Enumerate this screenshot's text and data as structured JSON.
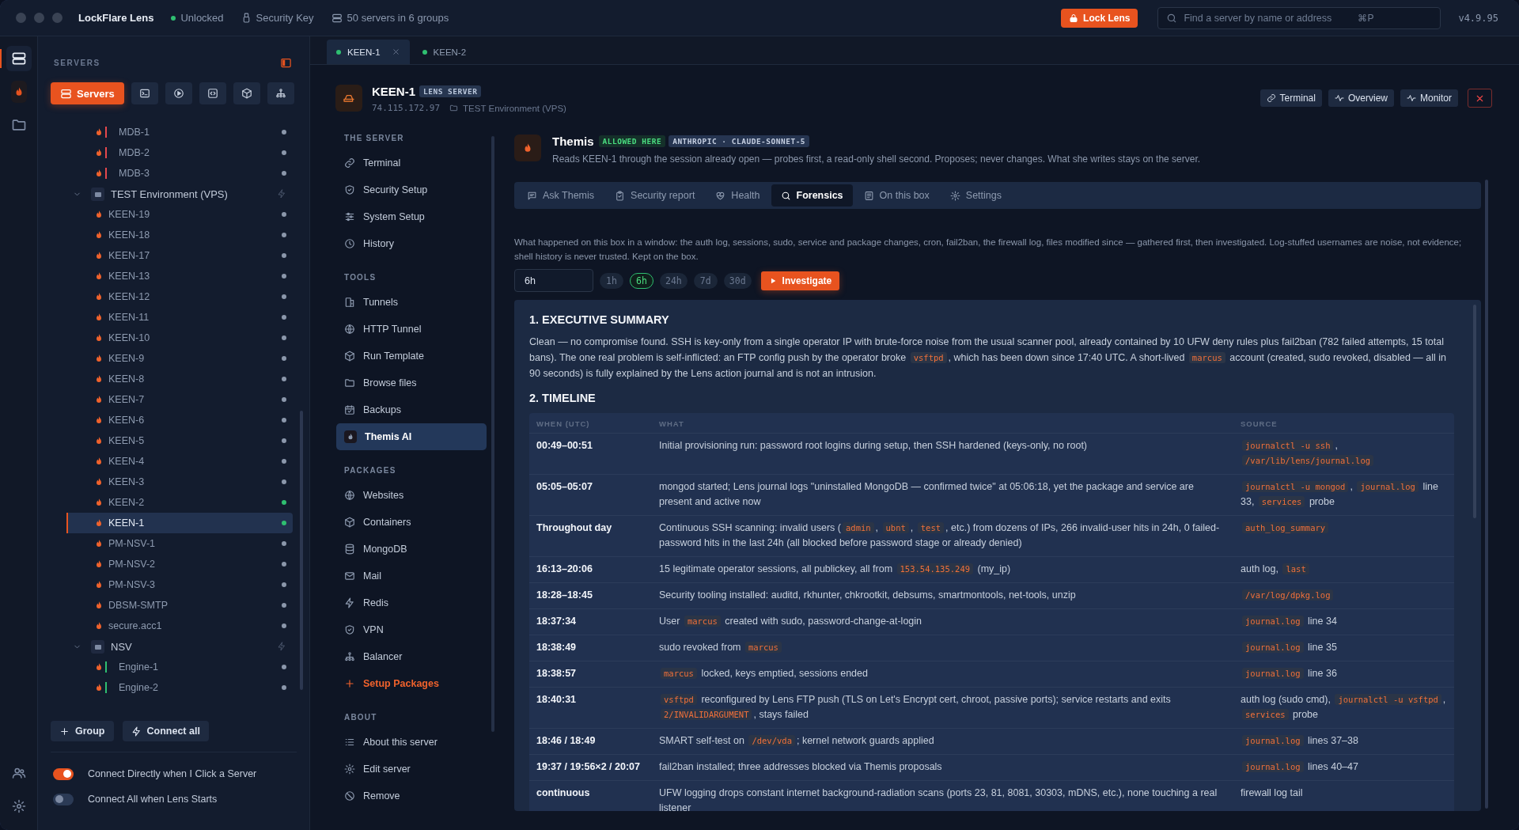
{
  "window": {
    "app_name": "LockFlare Lens",
    "lock_status": "Unlocked",
    "security_key": "Security Key",
    "server_count": "50 servers in 6 groups",
    "lock_button": "Lock Lens",
    "search": {
      "placeholder": "Find a server by name or address",
      "shortcut": "⌘P"
    },
    "version": "v4.9.95"
  },
  "rail": [
    {
      "selected": true
    },
    {
      "selected": false
    },
    {
      "selected": false
    }
  ],
  "sidebar": {
    "title": "SERVERS",
    "view_buttons": [
      {
        "label": "Servers",
        "selected": true
      },
      {
        "selected": false
      },
      {
        "selected": false
      },
      {
        "selected": false
      },
      {
        "selected": false
      },
      {
        "selected": false
      }
    ],
    "tree": [
      {
        "kind": "server",
        "name": "MDB-1",
        "tag": {
          "color": "#e5484d"
        },
        "color": "#8b97ab",
        "selected": false
      },
      {
        "kind": "server",
        "name": "MDB-2",
        "tag": {
          "color": "#e5484d"
        },
        "color": "#8b97ab",
        "selected": false
      },
      {
        "kind": "server",
        "name": "MDB-3",
        "tag": {
          "color": "#e5484d"
        },
        "color": "#8b97ab",
        "selected": false
      },
      {
        "kind": "group",
        "name": "TEST Environment (VPS)",
        "expanded": true,
        "children": [
          {
            "kind": "server",
            "name": "KEEN-19",
            "color": "#8b97ab",
            "selected": false
          },
          {
            "kind": "server",
            "name": "KEEN-18",
            "color": "#8b97ab",
            "selected": false
          },
          {
            "kind": "server",
            "name": "KEEN-17",
            "color": "#8b97ab",
            "selected": false
          },
          {
            "kind": "server",
            "name": "KEEN-13",
            "color": "#8b97ab",
            "selected": false
          },
          {
            "kind": "server",
            "name": "KEEN-12",
            "color": "#8b97ab",
            "selected": false
          },
          {
            "kind": "server",
            "name": "KEEN-11",
            "color": "#8b97ab",
            "selected": false
          },
          {
            "kind": "server",
            "name": "KEEN-10",
            "color": "#8b97ab",
            "selected": false
          },
          {
            "kind": "server",
            "name": "KEEN-9",
            "color": "#8b97ab",
            "selected": false
          },
          {
            "kind": "server",
            "name": "KEEN-8",
            "color": "#8b97ab",
            "selected": false
          },
          {
            "kind": "server",
            "name": "KEEN-7",
            "color": "#8b97ab",
            "selected": false
          },
          {
            "kind": "server",
            "name": "KEEN-6",
            "color": "#8b97ab",
            "selected": false
          },
          {
            "kind": "server",
            "name": "KEEN-5",
            "color": "#8b97ab",
            "selected": false
          },
          {
            "kind": "server",
            "name": "KEEN-4",
            "color": "#8b97ab",
            "selected": false
          },
          {
            "kind": "server",
            "name": "KEEN-3",
            "color": "#8b97ab",
            "selected": false
          },
          {
            "kind": "server",
            "name": "KEEN-2",
            "color": "#2fbf71",
            "selected": false
          },
          {
            "kind": "server",
            "name": "KEEN-1",
            "color": "#2fbf71",
            "selected": true
          },
          {
            "kind": "server",
            "name": "PM-NSV-1",
            "color": "#8b97ab",
            "selected": false
          },
          {
            "kind": "server",
            "name": "PM-NSV-2",
            "color": "#8b97ab",
            "selected": false
          },
          {
            "kind": "server",
            "name": "PM-NSV-3",
            "color": "#8b97ab",
            "selected": false
          },
          {
            "kind": "server",
            "name": "DBSM-SMTP",
            "color": "#8b97ab",
            "selected": false
          },
          {
            "kind": "server",
            "name": "secure.acc1",
            "color": "#8b97ab",
            "selected": false
          }
        ]
      },
      {
        "kind": "group",
        "name": "NSV",
        "expanded": true,
        "children": [
          {
            "kind": "server",
            "name": "Engine-1",
            "tag": {
              "color": "#2fbf71"
            },
            "color": "#8b97ab",
            "selected": false
          },
          {
            "kind": "server",
            "name": "Engine-2",
            "tag": {
              "color": "#2fbf71"
            },
            "color": "#8b97ab",
            "selected": false
          }
        ]
      }
    ],
    "buttons": [
      "Group",
      "Connect all"
    ],
    "toggles": [
      {
        "label": "Connect Directly when I Click a Server",
        "on": true
      },
      {
        "label": "Connect All when Lens Starts",
        "on": false
      }
    ]
  },
  "tabs": [
    {
      "label": "KEEN-1",
      "selected": true
    },
    {
      "label": "KEEN-2",
      "selected": false
    }
  ],
  "server": {
    "name": "KEEN-1",
    "badge": "LENS SERVER",
    "address": "74.115.172.97",
    "group": "TEST Environment (VPS)",
    "actions": [
      "Terminal",
      "Overview",
      "Monitor"
    ]
  },
  "nav": [
    {
      "heading": "THE SERVER",
      "items": [
        {
          "label": "Terminal",
          "kind": "page",
          "selected": false
        },
        {
          "label": "Security Setup",
          "kind": "page",
          "selected": false
        },
        {
          "label": "System Setup",
          "kind": "page",
          "selected": false
        },
        {
          "label": "History",
          "kind": "page",
          "selected": false
        }
      ]
    },
    {
      "heading": "TOOLS",
      "items": [
        {
          "label": "Tunnels",
          "kind": "page",
          "selected": false
        },
        {
          "label": "HTTP Tunnel",
          "kind": "page",
          "selected": false
        },
        {
          "label": "Run Template",
          "kind": "page",
          "selected": false
        },
        {
          "label": "Browse files",
          "kind": "page",
          "selected": false
        },
        {
          "label": "Backups",
          "kind": "page",
          "selected": false
        },
        {
          "label": "Themis AI",
          "kind": "page",
          "selected": true
        }
      ]
    },
    {
      "heading": "PACKAGES",
      "items": [
        {
          "label": "Websites",
          "kind": "page",
          "selected": false
        },
        {
          "label": "Containers",
          "kind": "page",
          "selected": false
        },
        {
          "label": "MongoDB",
          "kind": "page",
          "selected": false
        },
        {
          "label": "Mail",
          "kind": "page",
          "selected": false
        },
        {
          "label": "Redis",
          "kind": "page",
          "selected": false
        },
        {
          "label": "VPN",
          "kind": "page",
          "selected": false
        },
        {
          "label": "Balancer",
          "kind": "page",
          "selected": false
        },
        {
          "label": "Setup Packages",
          "kind": "action",
          "selected": false
        }
      ]
    },
    {
      "heading": "ABOUT",
      "items": [
        {
          "label": "About this server",
          "kind": "page",
          "selected": false
        },
        {
          "label": "Edit server",
          "kind": "page",
          "selected": false
        },
        {
          "label": "Remove",
          "kind": "page",
          "selected": false
        }
      ]
    }
  ],
  "assistant": {
    "name": "Themis",
    "badges": [
      {
        "kind": "status",
        "text": "ALLOWED HERE"
      },
      {
        "kind": "model",
        "text": "ANTHROPIC · CLAUDE-SONNET-5"
      }
    ],
    "description": "Reads KEEN-1 through the session already open — probes first, a read-only shell second. Proposes; never changes. What she writes stays on the server.",
    "tabs": [
      {
        "label": "Ask Themis",
        "selected": false
      },
      {
        "label": "Security report",
        "selected": false
      },
      {
        "label": "Health",
        "selected": false
      },
      {
        "label": "Forensics",
        "selected": true
      },
      {
        "label": "On this box",
        "selected": false
      },
      {
        "label": "Settings",
        "selected": false
      }
    ],
    "intro": "What happened on this box in a window: the auth log, sessions, sudo, service and package changes, cron, fail2ban, the firewall log, files modified since — gathered first, then investigated. Log-stuffed usernames are noise, not evidence; shell history is never trusted. Kept on the box.",
    "range": {
      "value": "6h",
      "presets": [
        {
          "label": "1h",
          "selected": false
        },
        {
          "label": "6h",
          "selected": true
        },
        {
          "label": "24h",
          "selected": false
        },
        {
          "label": "7d",
          "selected": false
        },
        {
          "label": "30d",
          "selected": false
        }
      ],
      "action": "Investigate"
    },
    "report": {
      "summary_heading": "1. EXECUTIVE SUMMARY",
      "summary": [
        {
          "text": "Clean — no compromise found. SSH is key-only from a single operator IP with brute-force noise from the usual scanner pool, already contained by 10 UFW deny rules plus fail2ban (782 failed attempts, 15 total bans). The one real problem is self-inflicted: an FTP config push by the operator broke "
        },
        {
          "code": "vsftpd"
        },
        {
          "text": ", which has been down since 17:40 UTC. A short-lived "
        },
        {
          "code": "marcus"
        },
        {
          "text": " account (created, sudo revoked, disabled — all in 90 seconds) is fully explained by the Lens action journal and is not an intrusion."
        }
      ],
      "timeline_heading": "2. TIMELINE",
      "timeline": {
        "columns": [
          "WHEN (UTC)",
          "WHAT",
          "SOURCE"
        ],
        "rows": [
          {
            "when": "00:49–00:51",
            "what": [
              {
                "text": "Initial provisioning run: password root logins during setup, then SSH hardened (keys-only, no root)"
              }
            ],
            "source": [
              {
                "code": "journalctl -u ssh"
              },
              {
                "text": ", "
              },
              {
                "code": "/var/lib/lens/journal.log"
              }
            ]
          },
          {
            "when": "05:05–05:07",
            "what": [
              {
                "text": "mongod started; Lens journal logs \"uninstalled MongoDB — confirmed twice\" at 05:06:18, yet the package and service are present and active now"
              }
            ],
            "source": [
              {
                "code": "journalctl -u mongod"
              },
              {
                "text": ", "
              },
              {
                "code": "journal.log"
              },
              {
                "text": " line 33, "
              },
              {
                "code": "services"
              },
              {
                "text": " probe"
              }
            ]
          },
          {
            "when": "Throughout day",
            "what": [
              {
                "text": "Continuous SSH scanning: invalid users ("
              },
              {
                "code": "admin"
              },
              {
                "text": ", "
              },
              {
                "code": "ubnt"
              },
              {
                "text": ", "
              },
              {
                "code": "test"
              },
              {
                "text": ", etc.) from dozens of IPs, 266 invalid-user hits in 24h, 0 failed-password hits in the last 24h (all blocked before password stage or already denied)"
              }
            ],
            "source": [
              {
                "code": "auth_log_summary"
              }
            ]
          },
          {
            "when": "16:13–20:06",
            "what": [
              {
                "text": "15 legitimate operator sessions, all publickey, all from "
              },
              {
                "code": "153.54.135.249"
              },
              {
                "text": " (my_ip)"
              }
            ],
            "source": [
              {
                "text": "auth log, "
              },
              {
                "code": "last"
              }
            ]
          },
          {
            "when": "18:28–18:45",
            "what": [
              {
                "text": "Security tooling installed: auditd, rkhunter, chkrootkit, debsums, smartmontools, net-tools, unzip"
              }
            ],
            "source": [
              {
                "code": "/var/log/dpkg.log"
              }
            ]
          },
          {
            "when": "18:37:34",
            "what": [
              {
                "text": "User "
              },
              {
                "code": "marcus"
              },
              {
                "text": " created with sudo, password-change-at-login"
              }
            ],
            "source": [
              {
                "code": "journal.log"
              },
              {
                "text": " line 34"
              }
            ]
          },
          {
            "when": "18:38:49",
            "what": [
              {
                "text": "sudo revoked from "
              },
              {
                "code": "marcus"
              }
            ],
            "source": [
              {
                "code": "journal.log"
              },
              {
                "text": " line 35"
              }
            ]
          },
          {
            "when": "18:38:57",
            "what": [
              {
                "code": "marcus"
              },
              {
                "text": " locked, keys emptied, sessions ended"
              }
            ],
            "source": [
              {
                "code": "journal.log"
              },
              {
                "text": " line 36"
              }
            ]
          },
          {
            "when": "18:40:31",
            "what": [
              {
                "code": "vsftpd"
              },
              {
                "text": " reconfigured by Lens FTP push (TLS on Let's Encrypt cert, chroot, passive ports); service restarts and exits "
              },
              {
                "code": "2/INVALIDARGUMENT"
              },
              {
                "text": ", stays failed"
              }
            ],
            "source": [
              {
                "text": "auth log (sudo cmd), "
              },
              {
                "code": "journalctl -u vsftpd"
              },
              {
                "text": ", "
              },
              {
                "code": "services"
              },
              {
                "text": " probe"
              }
            ]
          },
          {
            "when": "18:46 / 18:49",
            "what": [
              {
                "text": "SMART self-test on "
              },
              {
                "code": "/dev/vda"
              },
              {
                "text": "; kernel network guards applied"
              }
            ],
            "source": [
              {
                "code": "journal.log"
              },
              {
                "text": " lines 37–38"
              }
            ]
          },
          {
            "when": "19:37 / 19:56×2 / 20:07",
            "what": [
              {
                "text": "fail2ban installed; three addresses blocked via Themis proposals"
              }
            ],
            "source": [
              {
                "code": "journal.log"
              },
              {
                "text": " lines 40–47"
              }
            ]
          },
          {
            "when": "continuous",
            "what": [
              {
                "text": "UFW logging drops constant internet background-radiation scans (ports 23, 81, 8081, 30303, mDNS, etc.), none touching a real listener"
              }
            ],
            "source": [
              {
                "text": "firewall log tail"
              }
            ]
          }
        ]
      }
    }
  }
}
